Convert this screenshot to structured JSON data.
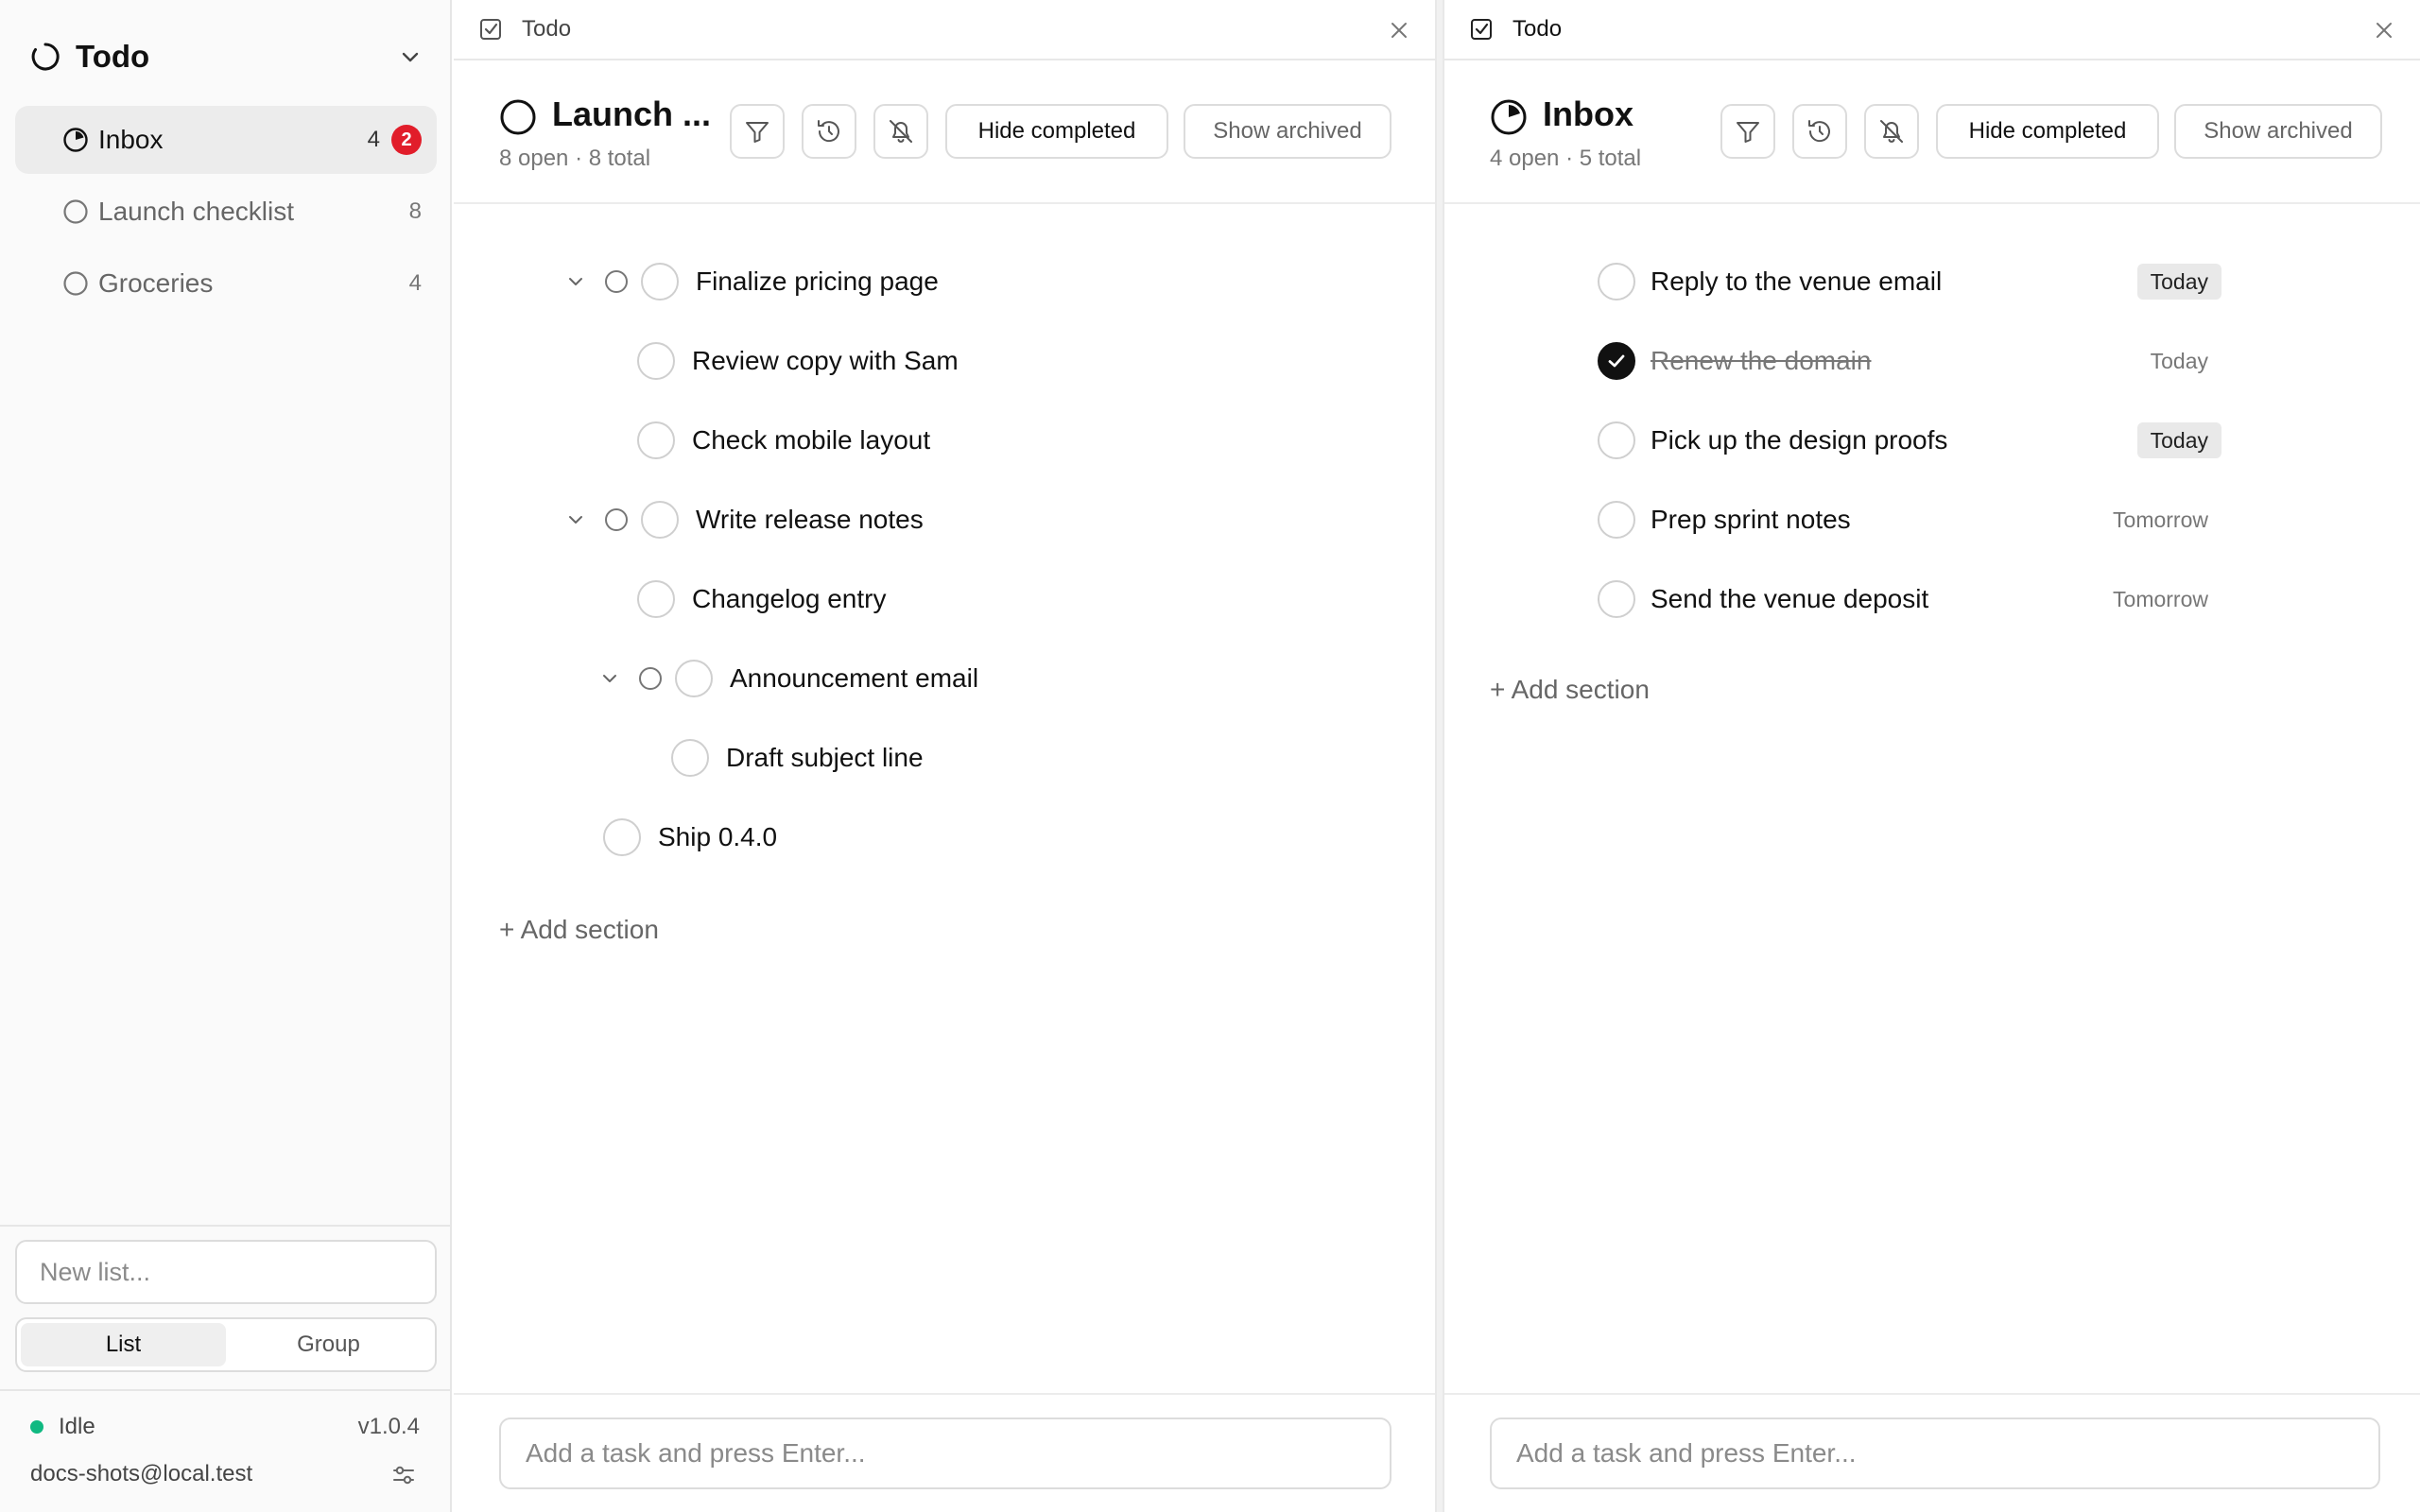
{
  "sidebar": {
    "title": "Todo",
    "items": [
      {
        "label": "Inbox",
        "count": "4",
        "badge": "2",
        "active": true
      },
      {
        "label": "Launch checklist",
        "count": "8"
      },
      {
        "label": "Groceries",
        "count": "4"
      }
    ],
    "new_list_placeholder": "New list...",
    "segments": [
      "List",
      "Group"
    ],
    "active_segment": "List",
    "status": "Idle",
    "status_color": "#10b981",
    "version": "v1.0.4",
    "account_email": "docs-shots@local.test"
  },
  "left_pane": {
    "tab_label": "Todo",
    "title": "Launch ...",
    "subtitle": "8 open · 8 total",
    "hide_completed_label": "Hide completed",
    "show_archived_label": "Show archived",
    "tasks": [
      {
        "label": "Finalize pricing page",
        "depth": 0,
        "has_children": true,
        "done": false
      },
      {
        "label": "Review copy with Sam",
        "depth": 1,
        "has_children": false,
        "done": false
      },
      {
        "label": "Check mobile layout",
        "depth": 1,
        "has_children": false,
        "done": false
      },
      {
        "label": "Write release notes",
        "depth": 0,
        "has_children": true,
        "done": false
      },
      {
        "label": "Changelog entry",
        "depth": 1,
        "has_children": false,
        "done": false
      },
      {
        "label": "Announcement email",
        "depth": 1,
        "has_children": true,
        "done": false
      },
      {
        "label": "Draft subject line",
        "depth": 2,
        "has_children": false,
        "done": false
      },
      {
        "label": "Ship 0.4.0",
        "depth": 0,
        "has_children": false,
        "done": false
      }
    ],
    "add_section_label": "+ Add section",
    "add_task_placeholder": "Add a task and press Enter..."
  },
  "right_pane": {
    "tab_label": "Todo",
    "title": "Inbox",
    "subtitle": "4 open · 5 total",
    "hide_completed_label": "Hide completed",
    "show_archived_label": "Show archived",
    "tasks": [
      {
        "label": "Reply to the venue email",
        "done": false,
        "due": "Today",
        "due_highlight": true
      },
      {
        "label": "Renew the domain",
        "done": true,
        "due": "Today",
        "due_highlight": false
      },
      {
        "label": "Pick up the design proofs",
        "done": false,
        "due": "Today",
        "due_highlight": true
      },
      {
        "label": "Prep sprint notes",
        "done": false,
        "due": "Tomorrow",
        "due_highlight": false
      },
      {
        "label": "Send the venue deposit",
        "done": false,
        "due": "Tomorrow",
        "due_highlight": false
      }
    ],
    "add_section_label": "+ Add section",
    "add_task_placeholder": "Add a task and press Enter..."
  },
  "colors": {
    "badge": "#e11d2a",
    "status_idle": "#10b981",
    "due_highlight_bg": "#e9e9e9"
  }
}
